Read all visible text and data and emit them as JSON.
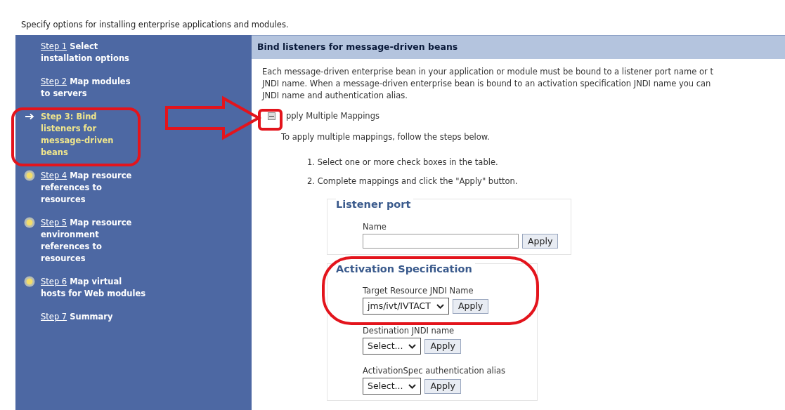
{
  "intro": "Specify options for installing enterprise applications and modules.",
  "steps": [
    {
      "link": "Step 1",
      "text": " Select\ninstallation options",
      "kind": "plain",
      "selected": false
    },
    {
      "link": "Step 2",
      "text": " Map modules\nto servers",
      "kind": "plain",
      "selected": false
    },
    {
      "link": "Step 3:",
      "text": " Bind\nlisteners for\nmessage-driven\nbeans",
      "kind": "current",
      "selected": true
    },
    {
      "link": "Step 4",
      "text": " Map resource\nreferences to\nresources",
      "kind": "pending",
      "selected": false
    },
    {
      "link": "Step 5",
      "text": " Map resource\nenvironment\nreferences to\nresources",
      "kind": "pending",
      "selected": false
    },
    {
      "link": "Step 6",
      "text": " Map virtual\nhosts for Web modules",
      "kind": "pending",
      "selected": false
    },
    {
      "link": "Step 7",
      "text": " Summary",
      "kind": "plain",
      "selected": false
    }
  ],
  "panel": {
    "title": "Bind listeners for message-driven beans",
    "description": [
      "Each message-driven enterprise bean in your application or module must be bound to a listener port name or t",
      "JNDI name. When a message-driven enterprise bean is bound to an activation specification JNDI name you can",
      "JNDI name and authentication alias."
    ],
    "section": {
      "label": "pply Multiple Mappings",
      "expanded": true
    },
    "instructions": "To apply multiple mappings, follow the steps below.",
    "steps": [
      "1. Select one or more check boxes in the table.",
      "2. Complete mappings and click the \"Apply\" button."
    ],
    "groups": [
      {
        "legend": "Listener port",
        "fields": [
          {
            "kind": "text",
            "label": "Name",
            "button": "Apply"
          }
        ]
      },
      {
        "legend": "Activation Specification",
        "fields": [
          {
            "kind": "select",
            "label": "Target Resource JNDI Name",
            "value": "jms/ivt/IVTACT",
            "button": "Apply"
          },
          {
            "kind": "select",
            "label": "Destination JNDI name",
            "value": "Select...",
            "button": "Apply"
          },
          {
            "kind": "select",
            "label": "ActivationSpec authentication alias",
            "value": "Select...",
            "button": "Apply"
          }
        ]
      }
    ]
  }
}
